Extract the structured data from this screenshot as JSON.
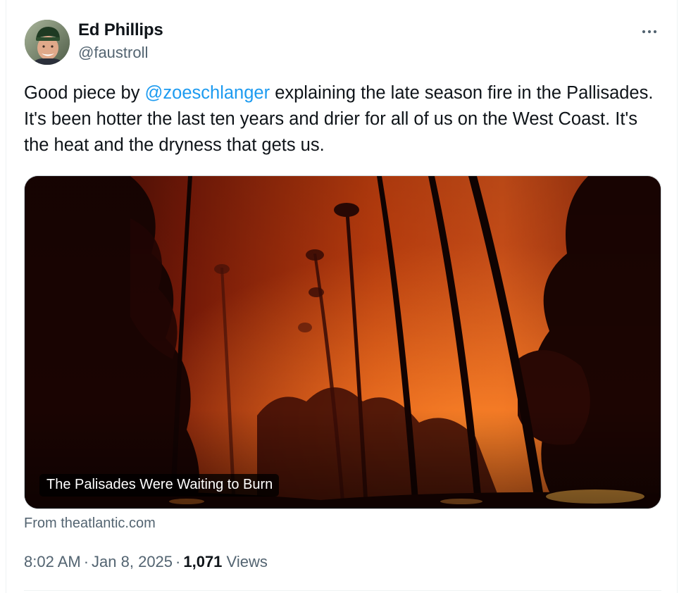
{
  "author": {
    "name": "Ed Phillips",
    "handle": "@faustroll",
    "avatar_icon": "user-avatar-photo"
  },
  "menu": {
    "icon": "more-horizontal-icon",
    "glyph": "···"
  },
  "tweet": {
    "text_before": "Good piece by ",
    "mention": "@zoeschlanger",
    "text_after": " explaining the late season fire in the Pallisades. It's been hotter the last ten years and drier for all of us on the West Coast. It's the heat and the dryness that gets us."
  },
  "link_card": {
    "caption": "The Palisades Were Waiting to Burn",
    "source": "From theatlantic.com",
    "image_icon": "wildfire-palm-trees-photo"
  },
  "meta": {
    "time": "8:02 AM",
    "separator": "·",
    "date": "Jan 8, 2025",
    "views_count": "1,071",
    "views_label": "Views"
  },
  "colors": {
    "accent": "#1d9bf0",
    "text_primary": "#0f1419",
    "text_secondary": "#536471",
    "border": "#cfd9de"
  }
}
